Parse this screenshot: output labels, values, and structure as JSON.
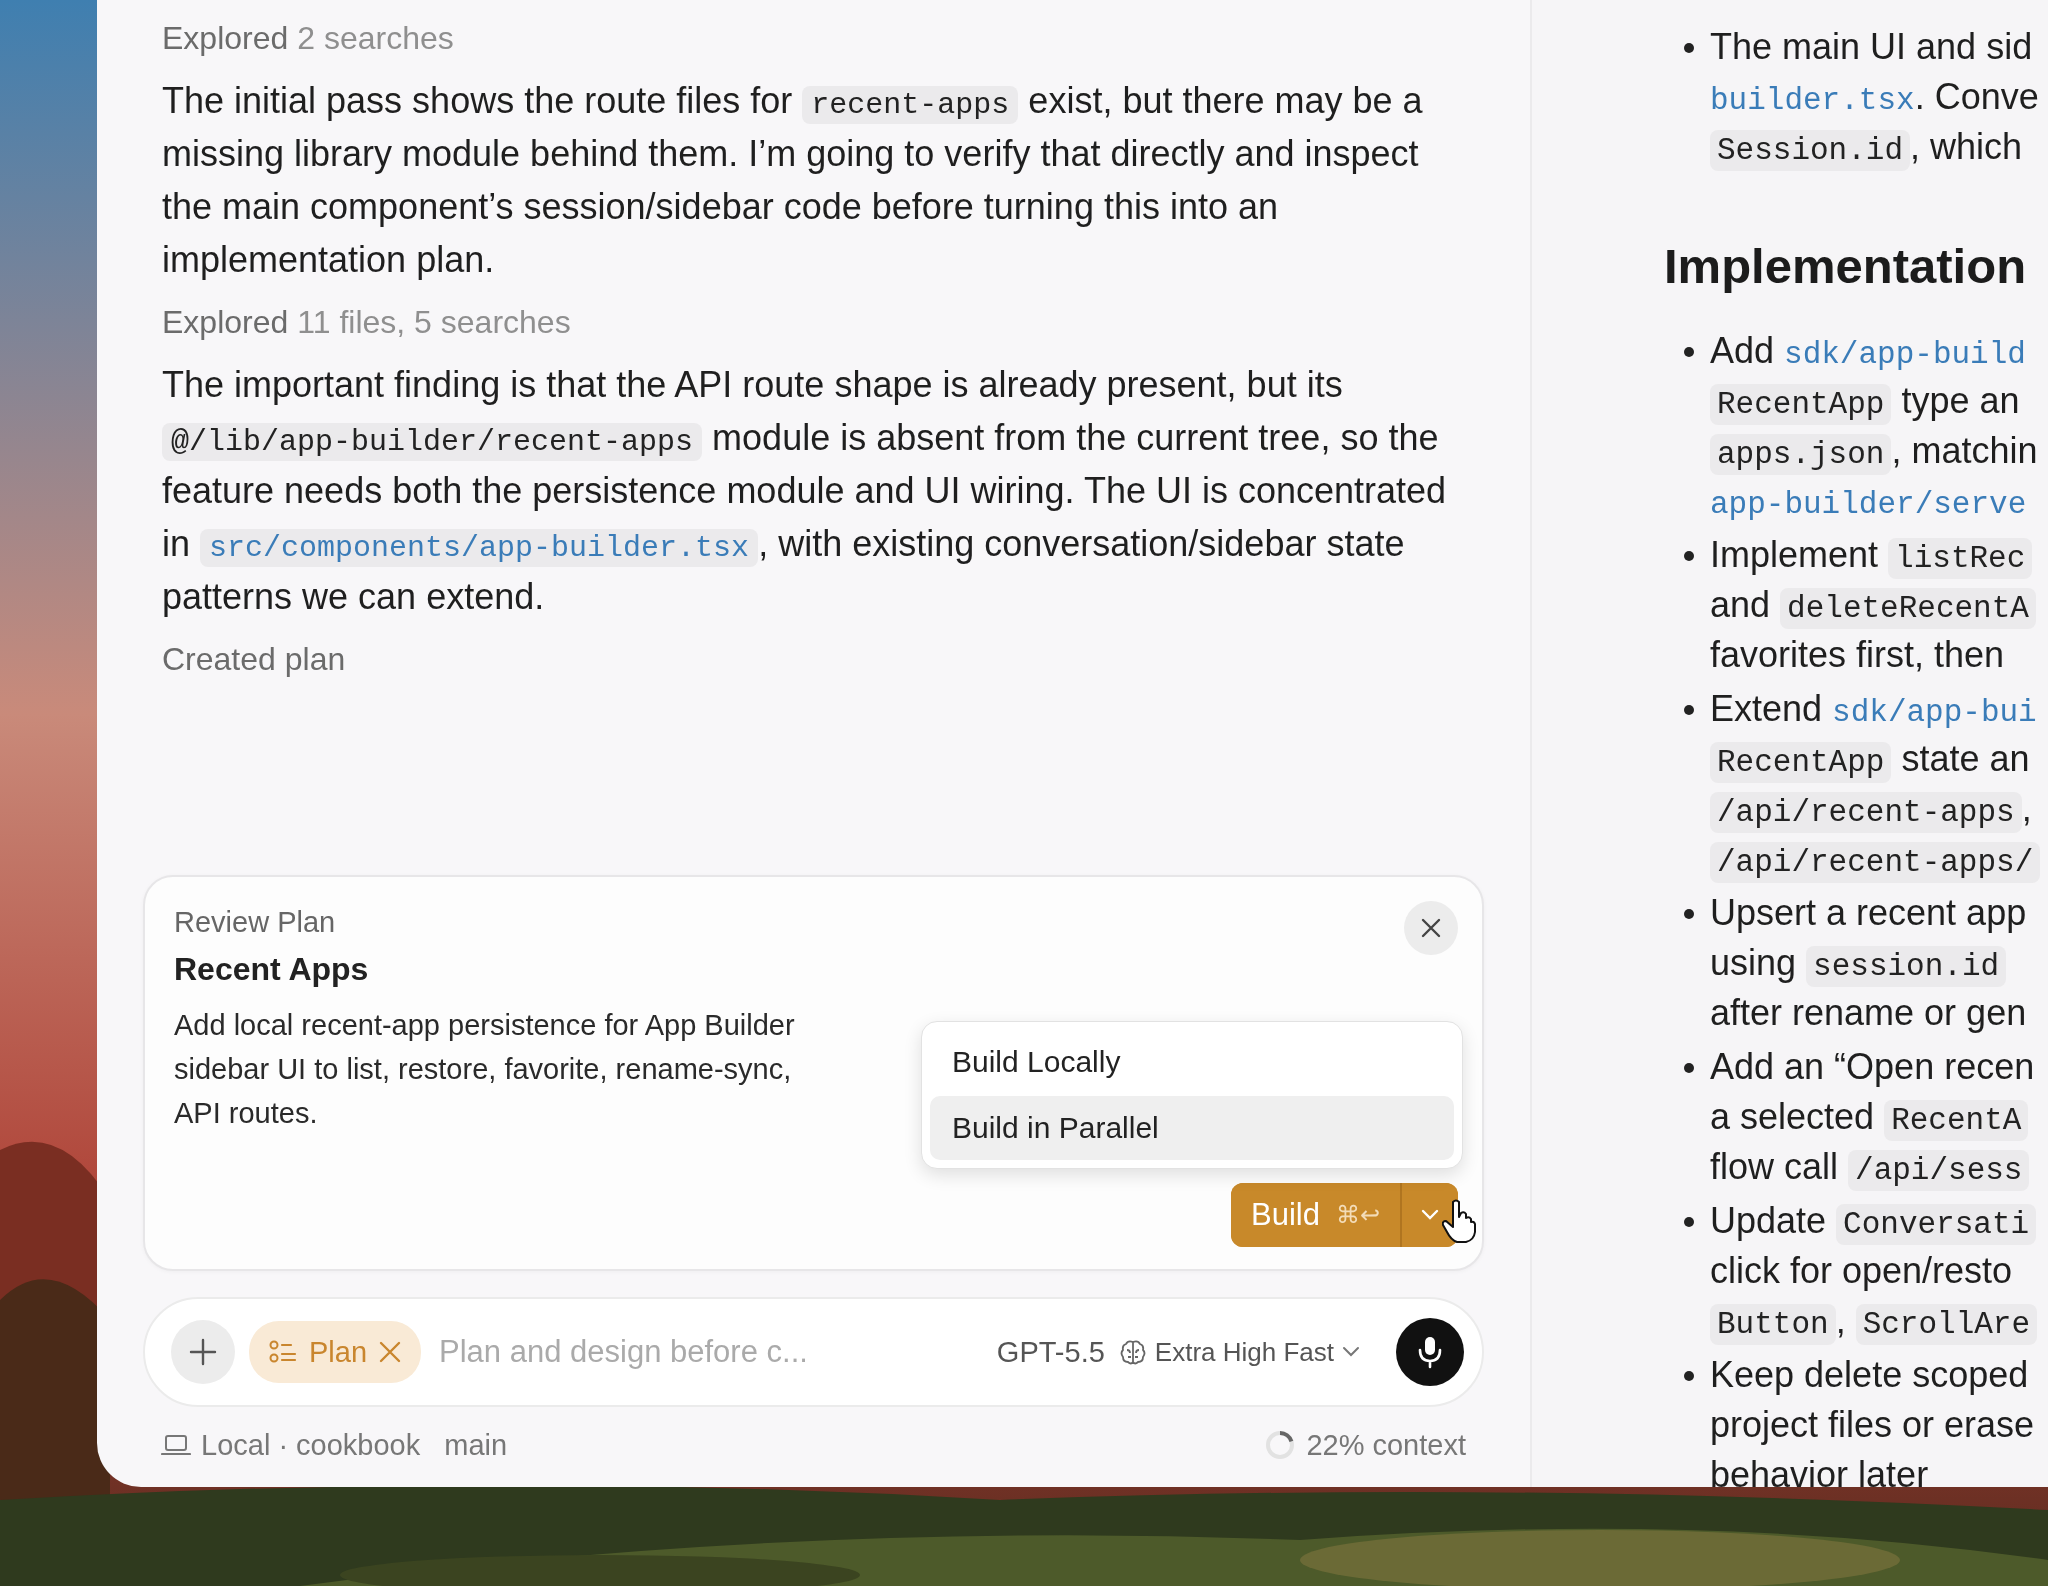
{
  "transcript": [
    {
      "kind": "activity",
      "label": "Explored",
      "detail": "2 searches"
    },
    {
      "kind": "paragraph",
      "segments": [
        {
          "kind": "text",
          "text": "The initial pass shows the route files for "
        },
        {
          "kind": "code",
          "text": "recent-apps"
        },
        {
          "kind": "text",
          "text": " exist, but there may be a missing library module behind them. I’m going to verify that directly and inspect the main component’s session/sidebar code before turning this into an implementation plan."
        }
      ]
    },
    {
      "kind": "activity",
      "label": "Explored",
      "detail": "11 files, 5 searches"
    },
    {
      "kind": "paragraph",
      "segments": [
        {
          "kind": "text",
          "text": "The important finding is that the API route shape is already present, but its "
        },
        {
          "kind": "code",
          "text": "@/lib/app-builder/recent-apps"
        },
        {
          "kind": "text",
          "text": " module is absent from the current tree, so the feature needs both the persistence module and UI wiring. The UI is concentrated in "
        },
        {
          "kind": "link",
          "text": "src/components/app-builder.tsx"
        },
        {
          "kind": "text",
          "text": ", with existing conversation/sidebar state patterns we can extend."
        }
      ]
    },
    {
      "kind": "activity",
      "label": "Created plan"
    }
  ],
  "review_plan": {
    "heading": "Review Plan",
    "title": "Recent Apps",
    "description_lines": [
      "Add local recent-app persistence for App Builder",
      "sidebar UI to list, restore, favorite, rename-sync,",
      "API routes."
    ],
    "build_menu": [
      {
        "label": "Build Locally",
        "selected": false
      },
      {
        "label": "Build in Parallel",
        "selected": true
      }
    ],
    "build_button": {
      "label": "Build",
      "shortcut": "⌘↩"
    }
  },
  "composer": {
    "mode": "Plan",
    "placeholder": "Plan and design before c...",
    "model": "GPT-5.5",
    "effort": "Extra High Fast"
  },
  "footer": {
    "location": "Local · cookbook",
    "branch": "main",
    "context": "22% context"
  },
  "plan_document": [
    {
      "kind": "bullet",
      "lines": [
        [
          {
            "kind": "text",
            "text": "The main UI and sid"
          }
        ],
        [
          {
            "kind": "link",
            "text": "builder.tsx"
          },
          {
            "kind": "text",
            "text": ". Conve"
          }
        ],
        [
          {
            "kind": "code",
            "text": "Session.id"
          },
          {
            "kind": "text",
            "text": ", which"
          }
        ]
      ]
    },
    {
      "kind": "heading",
      "text": "Implementation"
    },
    {
      "kind": "bullet",
      "lines": [
        [
          {
            "kind": "text",
            "text": "Add "
          },
          {
            "kind": "link",
            "text": "sdk/app-build"
          }
        ],
        [
          {
            "kind": "code",
            "text": "RecentApp"
          },
          {
            "kind": "text",
            "text": " type an"
          }
        ],
        [
          {
            "kind": "code",
            "text": "apps.json"
          },
          {
            "kind": "text",
            "text": ", matchin"
          }
        ],
        [
          {
            "kind": "link",
            "text": "app-builder/serve"
          }
        ]
      ]
    },
    {
      "kind": "bullet",
      "lines": [
        [
          {
            "kind": "text",
            "text": "Implement "
          },
          {
            "kind": "code",
            "text": "listRec"
          }
        ],
        [
          {
            "kind": "text",
            "text": "and "
          },
          {
            "kind": "code",
            "text": "deleteRecentA"
          }
        ],
        [
          {
            "kind": "text",
            "text": "favorites first, then"
          }
        ]
      ]
    },
    {
      "kind": "bullet",
      "lines": [
        [
          {
            "kind": "text",
            "text": "Extend "
          },
          {
            "kind": "link",
            "text": "sdk/app-bui"
          }
        ],
        [
          {
            "kind": "code",
            "text": "RecentApp"
          },
          {
            "kind": "text",
            "text": " state an"
          }
        ],
        [
          {
            "kind": "code",
            "text": "/api/recent-apps"
          },
          {
            "kind": "text",
            "text": ","
          }
        ],
        [
          {
            "kind": "code",
            "text": "/api/recent-apps/"
          }
        ]
      ]
    },
    {
      "kind": "bullet",
      "lines": [
        [
          {
            "kind": "text",
            "text": "Upsert a recent app"
          }
        ],
        [
          {
            "kind": "text",
            "text": "using "
          },
          {
            "kind": "code",
            "text": "session.id"
          }
        ],
        [
          {
            "kind": "text",
            "text": "after rename or gen"
          }
        ]
      ]
    },
    {
      "kind": "bullet",
      "lines": [
        [
          {
            "kind": "text",
            "text": "Add an “Open recen"
          }
        ],
        [
          {
            "kind": "text",
            "text": "a selected "
          },
          {
            "kind": "code",
            "text": "RecentA"
          }
        ],
        [
          {
            "kind": "text",
            "text": "flow call "
          },
          {
            "kind": "code",
            "text": "/api/sess"
          }
        ]
      ]
    },
    {
      "kind": "bullet",
      "lines": [
        [
          {
            "kind": "text",
            "text": "Update "
          },
          {
            "kind": "code",
            "text": "Conversati"
          }
        ],
        [
          {
            "kind": "text",
            "text": "click for open/resto"
          }
        ],
        [
          {
            "kind": "code",
            "text": "Button"
          },
          {
            "kind": "text",
            "text": ", "
          },
          {
            "kind": "code",
            "text": "ScrollAre"
          }
        ]
      ]
    },
    {
      "kind": "bullet",
      "lines": [
        [
          {
            "kind": "text",
            "text": "Keep delete scoped"
          }
        ],
        [
          {
            "kind": "text",
            "text": "project files or erase"
          }
        ],
        [
          {
            "kind": "text",
            "text": "behavior later"
          }
        ]
      ]
    }
  ]
}
